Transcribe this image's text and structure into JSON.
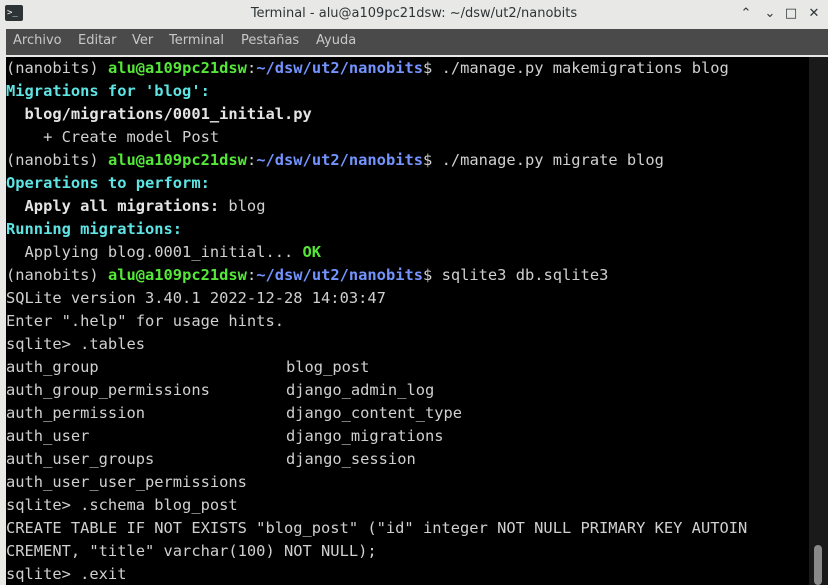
{
  "window": {
    "title": "Terminal - alu@a109pc21dsw: ~/dsw/ut2/nanobits",
    "controls": {
      "shade": "⌃",
      "minimize": "⌄",
      "maximize": "□",
      "close": "✕"
    }
  },
  "menu": {
    "items": [
      "Archivo",
      "Editar",
      "Ver",
      "Terminal",
      "Pestañas",
      "Ayuda"
    ]
  },
  "terminal": {
    "prompt": {
      "env": "(nanobits) ",
      "userhost": "alu@a109pc21dsw",
      "colon": ":",
      "path": "~/dsw/ut2/nanobits",
      "dollar": "$ "
    },
    "cmd1": "./manage.py makemigrations blog",
    "mig_header": "Migrations for 'blog':",
    "mig_file": "  blog/migrations/0001_initial.py",
    "mig_create": "    + Create model Post",
    "cmd2": "./manage.py migrate blog",
    "ops_header": "Operations to perform:",
    "apply_label": "  Apply all migrations:",
    "apply_value": " blog",
    "running_header": "Running migrations:",
    "applying_text": "  Applying blog.0001_initial...",
    "ok": " OK",
    "cmd3": "sqlite3 db.sqlite3",
    "sqlite_version": "SQLite version 3.40.1 2022-12-28 14:03:47",
    "help_hint": "Enter \".help\" for usage hints.",
    "tables_cmd": "sqlite> .tables",
    "tables": [
      [
        "auth_group",
        "blog_post"
      ],
      [
        "auth_group_permissions",
        "django_admin_log"
      ],
      [
        "auth_permission",
        "django_content_type"
      ],
      [
        "auth_user",
        "django_migrations"
      ],
      [
        "auth_user_groups",
        "django_session"
      ],
      [
        "auth_user_user_permissions",
        ""
      ]
    ],
    "schema_cmd": "sqlite> .schema blog_post",
    "schema_line1": "CREATE TABLE IF NOT EXISTS \"blog_post\" (\"id\" integer NOT NULL PRIMARY KEY AUTOIN",
    "schema_line2": "CREMENT, \"title\" varchar(100) NOT NULL);",
    "exit_cmd": "sqlite> .exit"
  },
  "colors": {
    "userhost": "#55e839",
    "path": "#7394ff",
    "header": "#5ee4e4",
    "ok": "#55e839",
    "background": "#000000"
  }
}
